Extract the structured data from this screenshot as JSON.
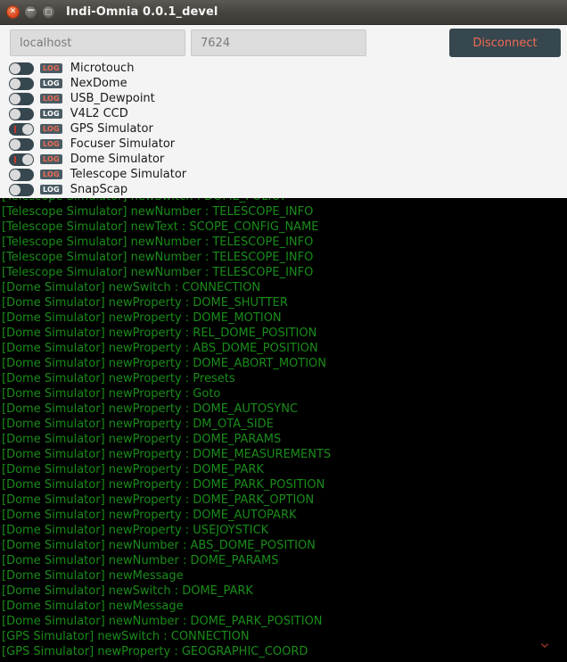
{
  "window": {
    "title": "Indi-Omnia 0.0.1_devel",
    "buttons": {
      "close": "×",
      "minimize": "−",
      "maximize": "□"
    }
  },
  "connection": {
    "host_value": "localhost",
    "host_placeholder": "localhost",
    "port_value": "7624",
    "port_placeholder": "7624",
    "disconnect_label": "Disconnect"
  },
  "devices": {
    "log_badge_label": "LOG",
    "items": [
      {
        "name": "Microtouch",
        "enabled": false,
        "log_active": true
      },
      {
        "name": "NexDome",
        "enabled": false,
        "log_active": false
      },
      {
        "name": "USB_Dewpoint",
        "enabled": false,
        "log_active": true
      },
      {
        "name": "V4L2 CCD",
        "enabled": false,
        "log_active": false
      },
      {
        "name": "GPS Simulator",
        "enabled": true,
        "log_active": true
      },
      {
        "name": "Focuser Simulator",
        "enabled": false,
        "log_active": true
      },
      {
        "name": "Dome Simulator",
        "enabled": true,
        "log_active": true
      },
      {
        "name": "Telescope Simulator",
        "enabled": false,
        "log_active": true
      },
      {
        "name": "SnapScap",
        "enabled": false,
        "log_active": false
      }
    ]
  },
  "console": {
    "text_color": "#1a8c1a",
    "background_color": "#000000",
    "lines": [
      "[Telescope Simulator] newSwitch : DOME_POLICY",
      "[Telescope Simulator] newNumber : TELESCOPE_INFO",
      "[Telescope Simulator] newText : SCOPE_CONFIG_NAME",
      "[Telescope Simulator] newNumber : TELESCOPE_INFO",
      "[Telescope Simulator] newNumber : TELESCOPE_INFO",
      "[Telescope Simulator] newNumber : TELESCOPE_INFO",
      "[Dome Simulator] newSwitch : CONNECTION",
      "[Dome Simulator] newProperty : DOME_SHUTTER",
      "[Dome Simulator] newProperty : DOME_MOTION",
      "[Dome Simulator] newProperty : REL_DOME_POSITION",
      "[Dome Simulator] newProperty : ABS_DOME_POSITION",
      "[Dome Simulator] newProperty : DOME_ABORT_MOTION",
      "[Dome Simulator] newProperty : Presets",
      "[Dome Simulator] newProperty : Goto",
      "[Dome Simulator] newProperty : DOME_AUTOSYNC",
      "[Dome Simulator] newProperty : DM_OTA_SIDE",
      "[Dome Simulator] newProperty : DOME_PARAMS",
      "[Dome Simulator] newProperty : DOME_MEASUREMENTS",
      "[Dome Simulator] newProperty : DOME_PARK",
      "[Dome Simulator] newProperty : DOME_PARK_POSITION",
      "[Dome Simulator] newProperty : DOME_PARK_OPTION",
      "[Dome Simulator] newProperty : DOME_AUTOPARK",
      "[Dome Simulator] newProperty : USEJOYSTICK",
      "[Dome Simulator] newNumber : ABS_DOME_POSITION",
      "[Dome Simulator] newNumber : DOME_PARAMS",
      "[Dome Simulator] newMessage",
      "[Dome Simulator] newSwitch : DOME_PARK",
      "[Dome Simulator] newMessage",
      "[Dome Simulator] newNumber : DOME_PARK_POSITION",
      "[GPS Simulator] newSwitch : CONNECTION",
      "[GPS Simulator] newProperty : GEOGRAPHIC_COORD"
    ]
  },
  "scroll": {
    "chevron_glyph": "⌄",
    "chevron_color": "#7e2f1f"
  },
  "theme": {
    "accent": "#ef6a52",
    "panel_bg": "#f4f4f4",
    "button_bg": "#37474f",
    "titlebar_bg": "#46433f"
  }
}
